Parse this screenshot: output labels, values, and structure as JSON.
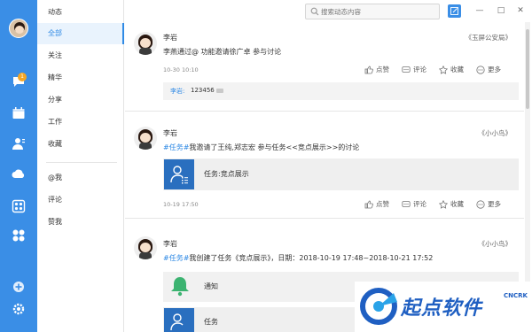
{
  "header": {
    "app_title": "动态",
    "search_placeholder": "搜索动态内容"
  },
  "rail": {
    "badge_count": "1",
    "icons": [
      "message-icon",
      "calendar-icon",
      "contacts-icon",
      "cloud-icon",
      "apps-icon",
      "grid-icon",
      "add-icon",
      "settings-icon"
    ]
  },
  "menu": {
    "items": [
      {
        "label": "全部"
      },
      {
        "label": "关注"
      },
      {
        "label": "精华"
      },
      {
        "label": "分享"
      },
      {
        "label": "工作"
      },
      {
        "label": "收藏"
      },
      {
        "label": "@我"
      },
      {
        "label": "评论"
      },
      {
        "label": "赞我"
      }
    ]
  },
  "actions": {
    "like": "点赞",
    "comment": "评论",
    "favorite": "收藏",
    "more": "更多"
  },
  "posts": [
    {
      "author": "李岩",
      "group": "《玉屏公安局》",
      "text": "李燕通过@ 功能邀请徐广卓 参与讨论",
      "time": "10-30 10:10",
      "comment_name": "李岩:",
      "comment_text": "123456"
    },
    {
      "author": "李岩",
      "group": "《小小鸟》",
      "tag": "#任务#",
      "text": "我邀请了王纯,郑志宏 参与任务<<竞点展示>>的讨论",
      "card_title": "任务:竞点展示",
      "time": "10-19 17:50"
    },
    {
      "author": "李岩",
      "group": "《小小鸟》",
      "tag": "#任务#",
      "text": "我创建了任务《竞点展示》，日期：2018-10-19 17:48~2018-10-21 17:52",
      "notice_title": "通知",
      "task_title": "任务"
    }
  ],
  "watermark": {
    "text": "起点软件",
    "sub": "CNCRK"
  },
  "colors": {
    "accent": "#3a8ee6",
    "link": "#2f8ae5",
    "bell": "#3cb371",
    "card_icon": "#2a6fbf"
  }
}
